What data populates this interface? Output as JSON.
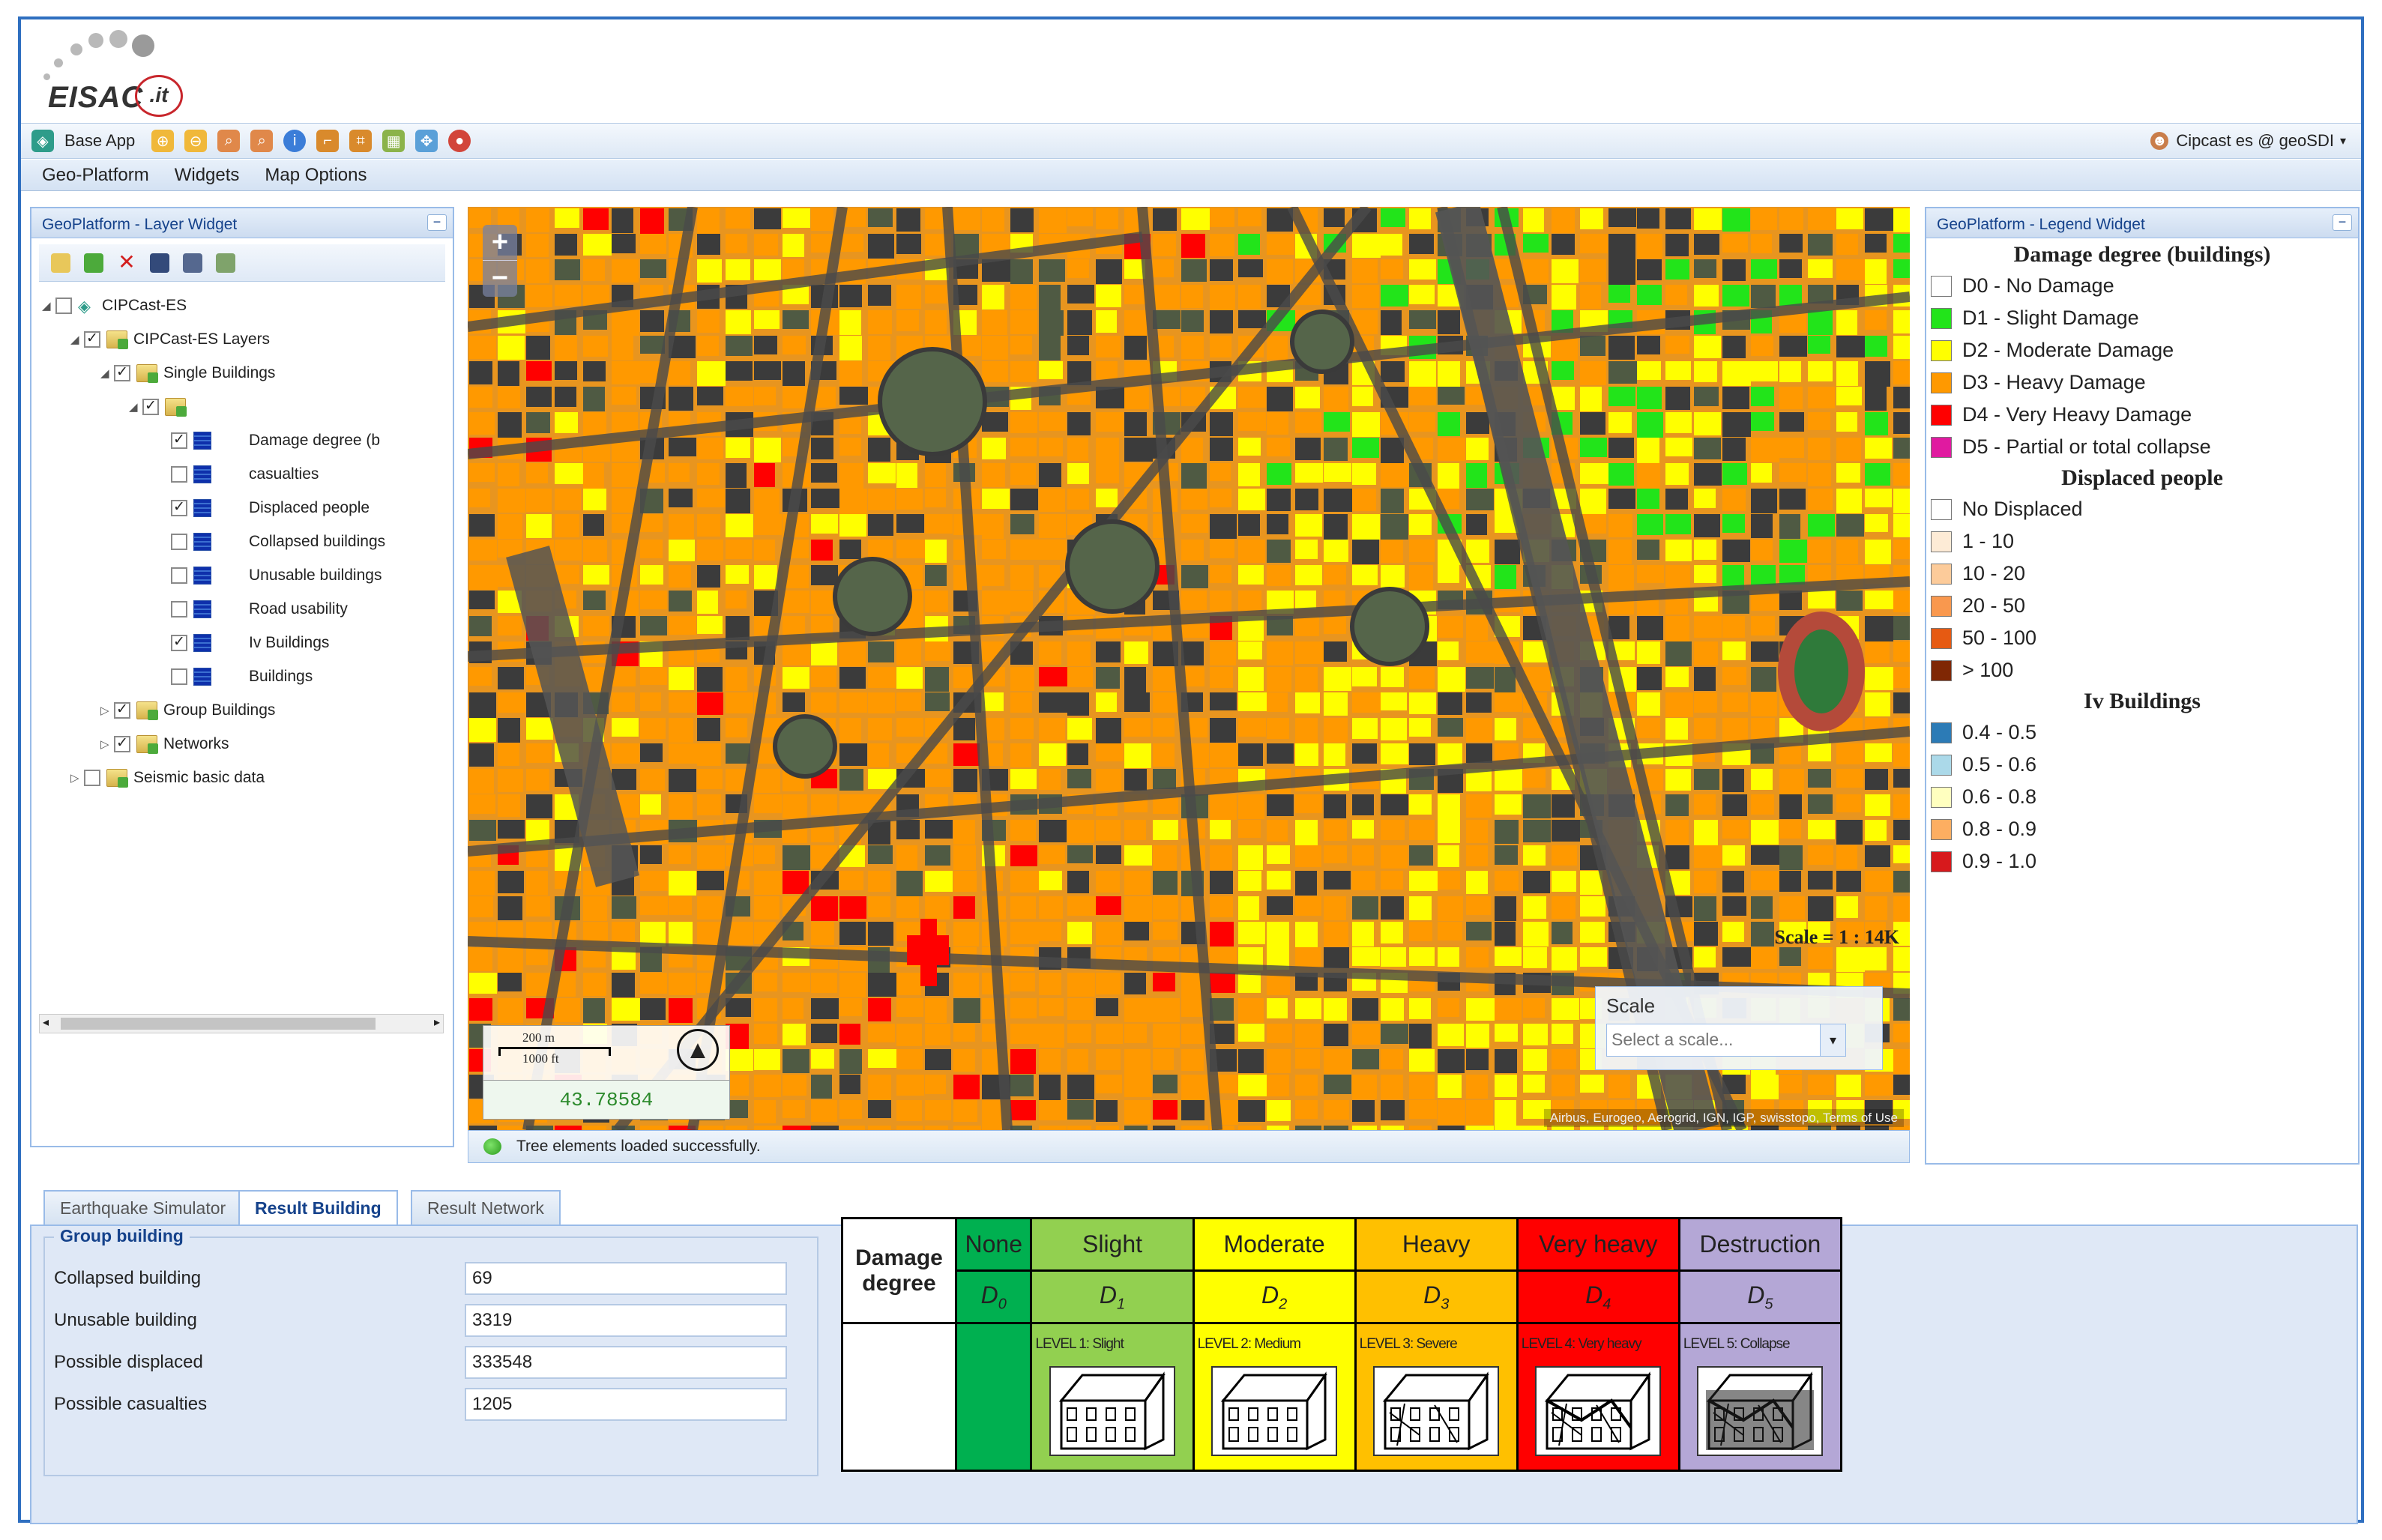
{
  "app": {
    "logo_text": "EISAC",
    "logo_suffix": ".it",
    "toolbar": {
      "base_app_label": "Base App",
      "icons": [
        "zoom-in-tool-icon",
        "zoom-out-tool-icon",
        "zoom-box-icon",
        "zoom-extent-icon",
        "info-icon",
        "measure-icon",
        "measure-area-icon",
        "layers-icon",
        "pan-icon",
        "globe-icon"
      ],
      "user_label": "Cipcast es @ geoSDI"
    },
    "menu": [
      "Geo-Platform",
      "Widgets",
      "Map Options"
    ]
  },
  "layer_widget": {
    "title": "GeoPlatform - Layer Widget",
    "tree": [
      {
        "label": "CIPCast-ES",
        "checked": false,
        "level": 0
      },
      {
        "label": "CIPCast-ES Layers",
        "checked": true,
        "level": 1
      },
      {
        "label": "Single Buildings",
        "checked": true,
        "level": 2
      },
      {
        "label": "",
        "checked": true,
        "level": 3
      },
      {
        "label": "Damage degree (b",
        "checked": true,
        "level": 4
      },
      {
        "label": "casualties",
        "checked": false,
        "level": 4
      },
      {
        "label": "Displaced people",
        "checked": true,
        "level": 4
      },
      {
        "label": "Collapsed buildings",
        "checked": false,
        "level": 4
      },
      {
        "label": "Unusable buildings",
        "checked": false,
        "level": 4
      },
      {
        "label": "Road usability",
        "checked": false,
        "level": 4
      },
      {
        "label": "Iv Buildings",
        "checked": true,
        "level": 4
      },
      {
        "label": "Buildings",
        "checked": false,
        "level": 4
      },
      {
        "label": "Group Buildings",
        "checked": true,
        "level": 2
      },
      {
        "label": "Networks",
        "checked": true,
        "level": 2
      },
      {
        "label": "Seismic basic data",
        "checked": false,
        "level": 1
      }
    ]
  },
  "map": {
    "zoom_in": "+",
    "zoom_out": "−",
    "scale_text": "Scale = 1 : 14K",
    "scalebar_m": "200 m",
    "scalebar_ft": "1000 ft",
    "coordinate": "43.78584",
    "scale_box_title": "Scale",
    "scale_placeholder": "Select a scale...",
    "attribution": "Airbus, Eurogeo, Aerogrid, IGN, IGP, swisstopo, Terms of Use"
  },
  "status": "Tree elements loaded successfully.",
  "legend_widget": {
    "title": "GeoPlatform - Legend Widget",
    "sections": [
      {
        "title": "Damage degree (buildings)",
        "items": [
          {
            "label": "D0 - No Damage",
            "color": "#ffffff"
          },
          {
            "label": "D1 - Slight Damage",
            "color": "#22e41a"
          },
          {
            "label": "D2 - Moderate Damage",
            "color": "#ffff00"
          },
          {
            "label": "D3 - Heavy Damage",
            "color": "#ff9900"
          },
          {
            "label": "D4 - Very Heavy Damage",
            "color": "#ff0000"
          },
          {
            "label": "D5 - Partial or total collapse",
            "color": "#e01aa0"
          }
        ]
      },
      {
        "title": "Displaced people",
        "items": [
          {
            "label": "No Displaced",
            "color": "#ffffff"
          },
          {
            "label": "1 - 10",
            "color": "#fdebd6"
          },
          {
            "label": "10 - 20",
            "color": "#fccb9a"
          },
          {
            "label": "20 - 50",
            "color": "#f9984e"
          },
          {
            "label": "50 - 100",
            "color": "#e65a12"
          },
          {
            "label": "> 100",
            "color": "#7f2704"
          }
        ]
      },
      {
        "title": "Iv Buildings",
        "items": [
          {
            "label": "0.4 - 0.5",
            "color": "#2c7bb6"
          },
          {
            "label": "0.5 - 0.6",
            "color": "#abd9e9"
          },
          {
            "label": "0.6 - 0.8",
            "color": "#ffffbf"
          },
          {
            "label": "0.8 - 0.9",
            "color": "#fdae61"
          },
          {
            "label": "0.9 - 1.0",
            "color": "#d7191c"
          }
        ]
      }
    ]
  },
  "bottom": {
    "tabs": [
      "Earthquake Simulator",
      "Result Building",
      "Result Network"
    ],
    "active_tab": "Result Building",
    "group_title": "Group building",
    "fields": [
      {
        "label": "Collapsed building",
        "value": "69"
      },
      {
        "label": "Unusable building",
        "value": "3319"
      },
      {
        "label": "Possible displaced",
        "value": "333548"
      },
      {
        "label": "Possible casualties",
        "value": "1205"
      }
    ]
  },
  "damage_table": {
    "header_label": "Damage degree",
    "columns": [
      {
        "name": "None",
        "symbol": "D",
        "sub": "0",
        "level": "",
        "color": "#00b050"
      },
      {
        "name": "Slight",
        "symbol": "D",
        "sub": "1",
        "level": "LEVEL 1: Slight",
        "color": "#92d050"
      },
      {
        "name": "Moderate",
        "symbol": "D",
        "sub": "2",
        "level": "LEVEL 2: Medium",
        "color": "#ffff00"
      },
      {
        "name": "Heavy",
        "symbol": "D",
        "sub": "3",
        "level": "LEVEL 3: Severe",
        "color": "#ffc000"
      },
      {
        "name": "Very heavy",
        "symbol": "D",
        "sub": "4",
        "level": "LEVEL 4: Very heavy",
        "color": "#ff0000"
      },
      {
        "name": "Destruction",
        "symbol": "D",
        "sub": "5",
        "level": "LEVEL 5: Collapse",
        "color": "#b4a7d6"
      }
    ]
  }
}
